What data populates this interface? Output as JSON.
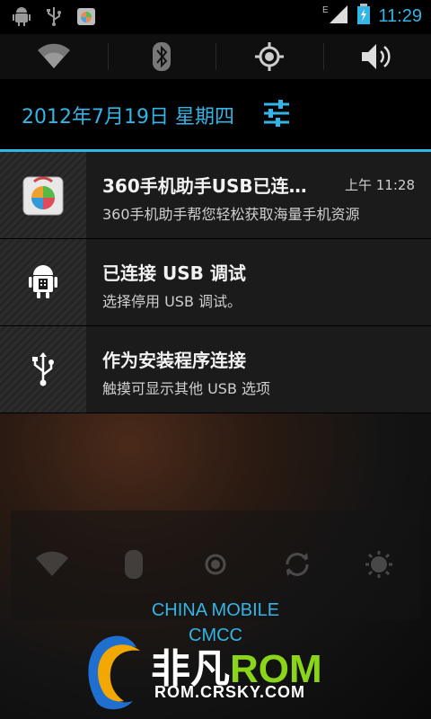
{
  "status_bar": {
    "icons_left": [
      "android-debug-icon",
      "usb-icon",
      "app-360-icon"
    ],
    "network": "E",
    "time": "11:29"
  },
  "quick_toggles": [
    "wifi-icon",
    "bluetooth-icon",
    "gps-icon",
    "volume-icon"
  ],
  "header": {
    "date": "2012年7月19日 星期四",
    "settings_icon": "settings-sliders-icon"
  },
  "notifications": [
    {
      "icon": "app-360-icon",
      "title": "360手机助手USB已连…",
      "time": "上午 11:28",
      "text": "360手机助手帮您轻松获取海量手机资源"
    },
    {
      "icon": "android-debug-icon",
      "title": "已连接 USB 调试",
      "time": "",
      "text": "选择停用 USB 调试。"
    },
    {
      "icon": "usb-icon",
      "title": "作为安装程序连接",
      "time": "",
      "text": "触摸可显示其他 USB 选项"
    }
  ],
  "carrier": {
    "line1": "CHINA  MOBILE",
    "line2": "CMCC"
  },
  "watermark": {
    "brand_cn": "非凡",
    "brand_rom": "ROM",
    "url": "ROM.CRSKY.COM"
  },
  "colors": {
    "accent": "#33b5e5",
    "rom_green": "#8ad41a"
  }
}
